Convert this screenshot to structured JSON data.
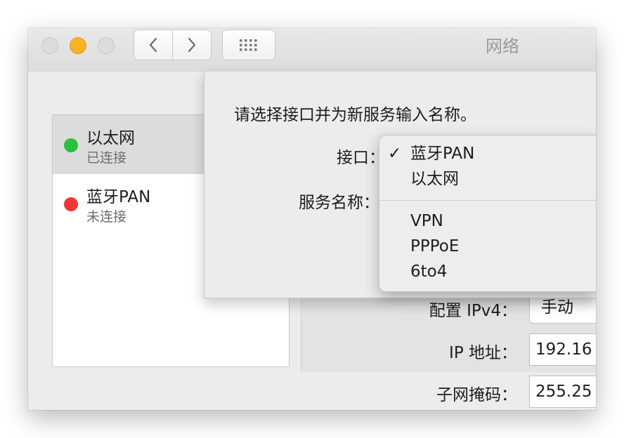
{
  "window": {
    "title": "网络"
  },
  "sidebar": {
    "services": [
      {
        "name": "以太网",
        "status": "已连接",
        "status_color": "#26c23e"
      },
      {
        "name": "蓝牙PAN",
        "status": "未连接",
        "status_color": "#f23535"
      }
    ]
  },
  "details": {
    "configure_label": "配置 IPv4：",
    "configure_value": "手动",
    "ip_label": "IP 地址：",
    "ip_value": "192.16",
    "subnet_label": "子网掩码：",
    "subnet_value": "255.25"
  },
  "sheet": {
    "prompt": "请选择接口并为新服务输入名称。",
    "interface_label": "接口：",
    "service_name_label": "服务名称："
  },
  "menu": {
    "check_glyph": "✓",
    "items": [
      "蓝牙PAN",
      "以太网",
      "VPN",
      "PPPoE",
      "6to4"
    ],
    "selected_index": 0
  },
  "colors": {
    "minimize_button": "#fdb126",
    "connected": "#26c23e",
    "disconnected": "#f23535"
  },
  "icons": {
    "back": "chevron-left-icon",
    "forward": "chevron-right-icon",
    "show_all": "grid-icon"
  }
}
